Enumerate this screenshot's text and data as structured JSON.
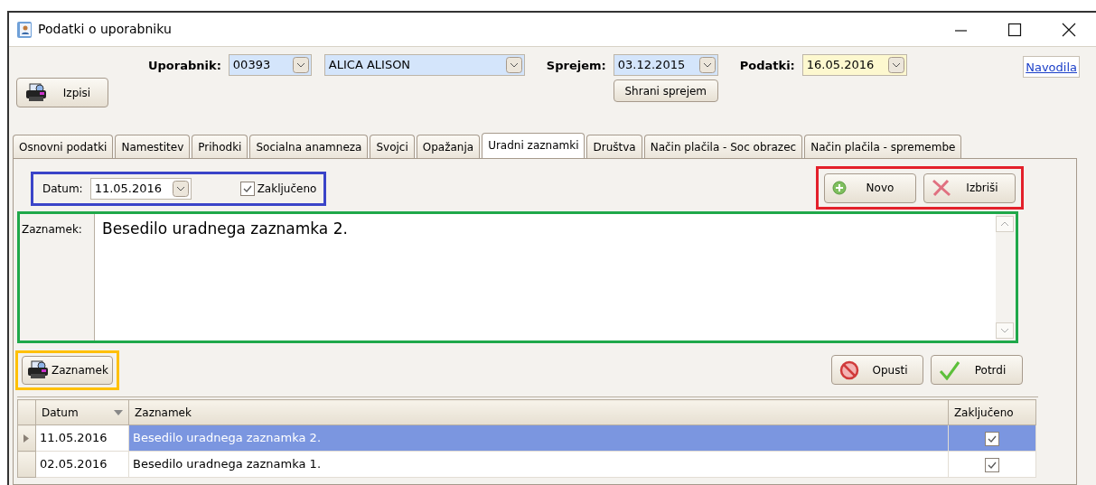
{
  "window": {
    "title": "Podatki o uporabniku"
  },
  "toolbar": {
    "print_button": "Izpisi",
    "user_label": "Uporabnik:",
    "user_code": "00393",
    "user_name": "ALICA ALISON",
    "admission_label": "Sprejem:",
    "admission_date": "03.12.2015",
    "save_admission_button": "Shrani sprejem",
    "data_label": "Podatki:",
    "data_date": "16.05.2016",
    "help_link": "Navodila"
  },
  "tabs": [
    {
      "label": "Osnovni podatki",
      "selected": false
    },
    {
      "label": "Namestitev",
      "selected": false
    },
    {
      "label": "Prihodki",
      "selected": false
    },
    {
      "label": "Socialna anamneza",
      "selected": false
    },
    {
      "label": "Svojci",
      "selected": false
    },
    {
      "label": "Opažanja",
      "selected": false
    },
    {
      "label": "Uradni zaznamki",
      "selected": true
    },
    {
      "label": "Društva",
      "selected": false
    },
    {
      "label": "Način plačila - Soc obrazec",
      "selected": false
    },
    {
      "label": "Način plačila - spremembe",
      "selected": false
    }
  ],
  "note_form": {
    "date_label": "Datum:",
    "date_value": "11.05.2016",
    "closed_label": "Zaključeno",
    "closed_checked": true,
    "date_frame": {
      "color": "#3a44c8"
    },
    "actions": [
      {
        "kind": "new",
        "label": "Novo"
      },
      {
        "kind": "delete",
        "label": "Izbriši"
      }
    ],
    "actions_frame": {
      "color": "#e3202a"
    },
    "note_label": "Zaznamek:",
    "note_text": "Besedilo uradnega zaznamka 2.",
    "note_frame": {
      "color": "#1fa84a"
    },
    "print_label": "Zaznamek",
    "print_frame": {
      "color": "#ffc000"
    },
    "confirm_actions": [
      {
        "kind": "cancel",
        "label": "Opusti"
      },
      {
        "kind": "confirm",
        "label": "Potrdi"
      }
    ]
  },
  "table": {
    "columns": [
      {
        "label": "Datum",
        "sorted": true
      },
      {
        "label": "Zaznamek",
        "sorted": false
      },
      {
        "label": "Zaključeno",
        "sorted": false
      }
    ],
    "rows": [
      {
        "date": "11.05.2016",
        "note": "Besedilo uradnega zaznamka 2.",
        "closed": true,
        "selected": true
      },
      {
        "date": "02.05.2016",
        "note": "Besedilo uradnega zaznamka 1.",
        "closed": true,
        "selected": false
      }
    ]
  }
}
